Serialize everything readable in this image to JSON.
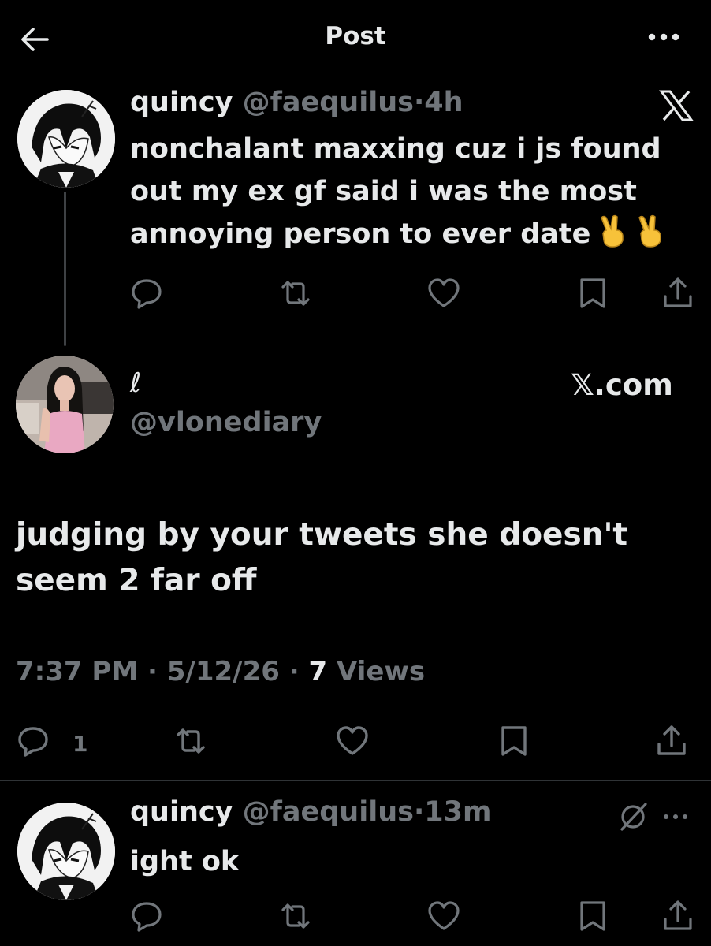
{
  "header": {
    "title": "Post",
    "back_icon": "arrow-left-icon",
    "more_icon": "more-horizontal-icon"
  },
  "tweet1": {
    "name": "quincy",
    "handle": "@faequilus",
    "time": "4h",
    "text_lines": [
      "nonchalant maxxing cuz i js found",
      "out my ex gf said i was the most",
      "annoying person to ever date"
    ],
    "emojis": [
      "victory-hand-emoji",
      "victory-hand-emoji"
    ],
    "badge_icon": "x-logo-icon"
  },
  "quoted": {
    "name": "ℓ",
    "handle": "@vlonediary",
    "source": "𝕏.com",
    "text_lines": [
      "judging by your tweets she doesn't",
      "seem 2 far off"
    ]
  },
  "meta": {
    "time": "7:37 PM",
    "date": "5/12/26",
    "views_count": "7",
    "views_label": "Views"
  },
  "main_actions": {
    "reply_count": "1"
  },
  "tweet3": {
    "name": "quincy",
    "handle": "@faequilus",
    "time": "13m",
    "text": "ight ok",
    "status_icon": "muted-circle-slash-icon"
  },
  "colors": {
    "background": "#000000",
    "text": "#e7e9ea",
    "secondary": "#71767b",
    "divider": "#2f3336"
  }
}
